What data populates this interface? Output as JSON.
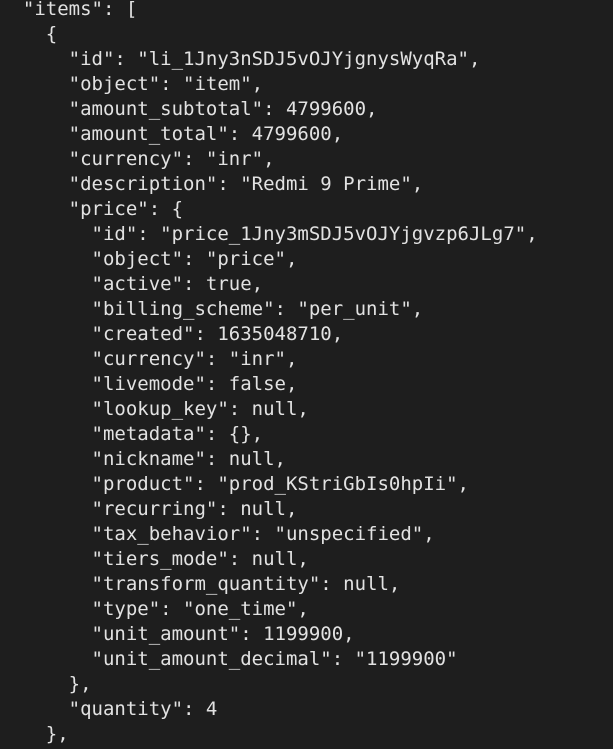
{
  "editor": {
    "lines": [
      "  \"items\": [",
      "    {",
      "      \"id\": \"li_1Jny3nSDJ5vOJYjgnysWyqRa\",",
      "      \"object\": \"item\",",
      "      \"amount_subtotal\": 4799600,",
      "      \"amount_total\": 4799600,",
      "      \"currency\": \"inr\",",
      "      \"description\": \"Redmi 9 Prime\",",
      "      \"price\": {",
      "        \"id\": \"price_1Jny3mSDJ5vOJYjgvzp6JLg7\",",
      "        \"object\": \"price\",",
      "        \"active\": true,",
      "        \"billing_scheme\": \"per_unit\",",
      "        \"created\": 1635048710,",
      "        \"currency\": \"inr\",",
      "        \"livemode\": false,",
      "        \"lookup_key\": null,",
      "        \"metadata\": {},",
      "        \"nickname\": null,",
      "        \"product\": \"prod_KStriGbIs0hpIi\",",
      "        \"recurring\": null,",
      "        \"tax_behavior\": \"unspecified\",",
      "        \"tiers_mode\": null,",
      "        \"transform_quantity\": null,",
      "        \"type\": \"one_time\",",
      "        \"unit_amount\": 1199900,",
      "        \"unit_amount_decimal\": \"1199900\"",
      "      },",
      "      \"quantity\": 4",
      "    },"
    ]
  }
}
